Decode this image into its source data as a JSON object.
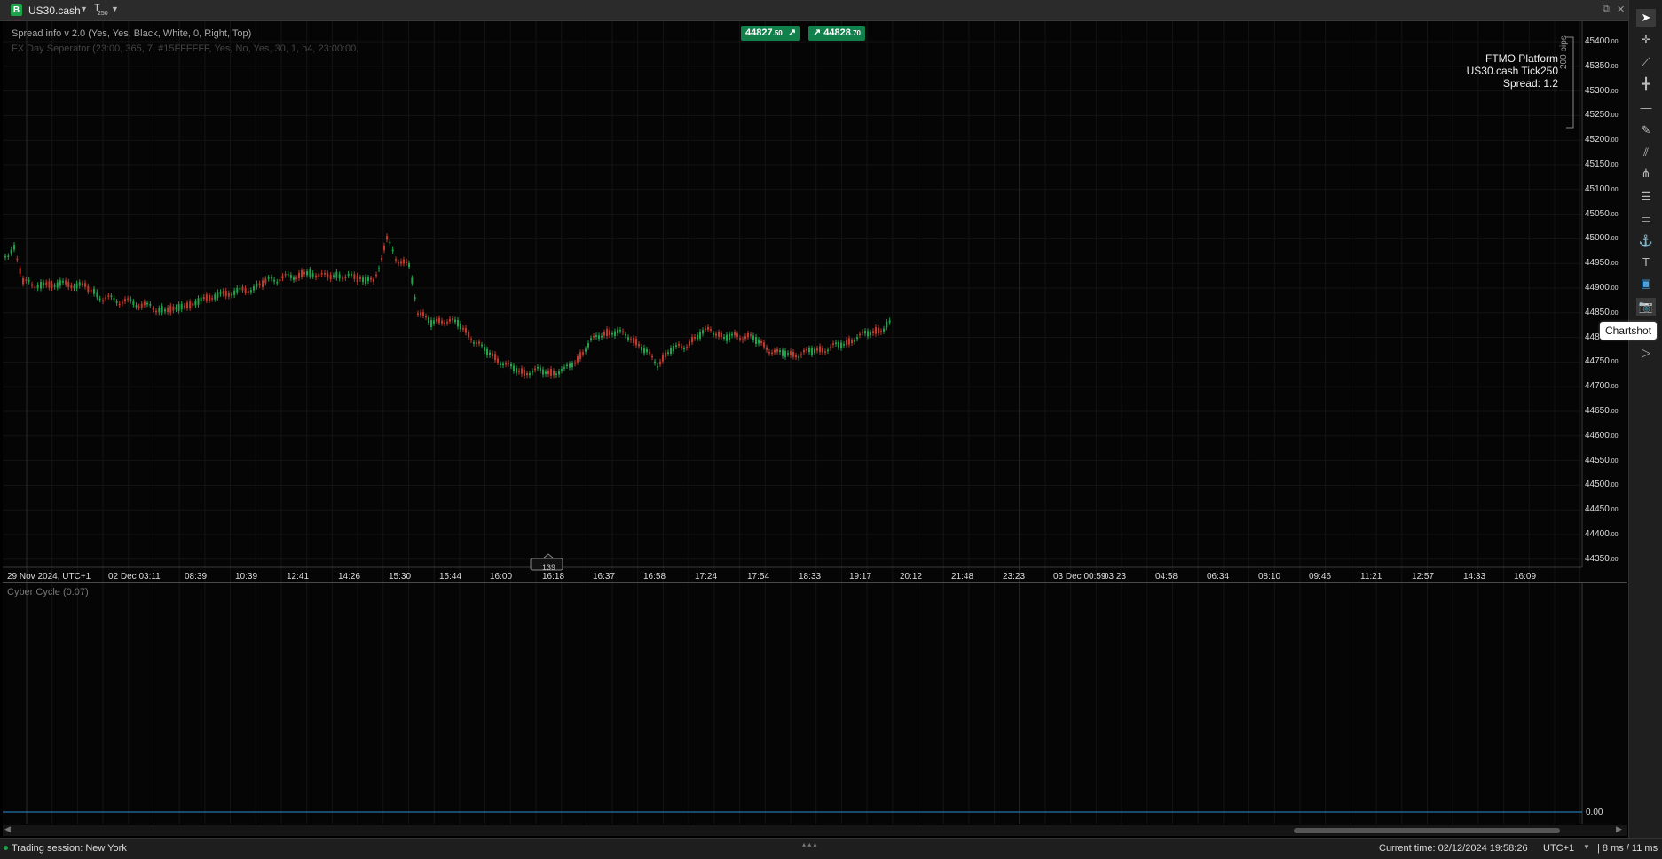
{
  "header": {
    "symbol_badge": "B",
    "symbol": "US30.cash",
    "timeframe_icon": "T",
    "timeframe_sub": "250"
  },
  "indicators": {
    "spread_info": "Spread info v 2.0 (Yes, Yes, Black, White, 0, Right, Top)",
    "day_separator": "FX Day Seperator (23:00, 365, 7, #15FFFFFF, Yes, No, Yes, 30, 1, h4, 23:00:00,",
    "cyber_cycle": "Cyber Cycle (0.07)"
  },
  "prices": {
    "bid_main": "44827",
    "bid_frac": ".50",
    "ask_main": "44828",
    "ask_frac": ".70"
  },
  "info_panel": {
    "line1": "FTMO Platform",
    "line2": "US30.cash Tick250",
    "line3": "Spread: 1.2"
  },
  "pips_label": "200 pips",
  "y_axis": [
    {
      "m": "45400",
      "f": ".00"
    },
    {
      "m": "45350",
      "f": ".00"
    },
    {
      "m": "45300",
      "f": ".00"
    },
    {
      "m": "45250",
      "f": ".00"
    },
    {
      "m": "45200",
      "f": ".00"
    },
    {
      "m": "45150",
      "f": ".00"
    },
    {
      "m": "45100",
      "f": ".00"
    },
    {
      "m": "45050",
      "f": ".00"
    },
    {
      "m": "45000",
      "f": ".00"
    },
    {
      "m": "44950",
      "f": ".00"
    },
    {
      "m": "44900",
      "f": ".00"
    },
    {
      "m": "44850",
      "f": ".00"
    },
    {
      "m": "448",
      "f": ""
    },
    {
      "m": "44750",
      "f": ".00"
    },
    {
      "m": "44700",
      "f": ".00"
    },
    {
      "m": "44650",
      "f": ".00"
    },
    {
      "m": "44600",
      "f": ".00"
    },
    {
      "m": "44550",
      "f": ".00"
    },
    {
      "m": "44500",
      "f": ".00"
    },
    {
      "m": "44450",
      "f": ".00"
    },
    {
      "m": "44400",
      "f": ".00"
    },
    {
      "m": "44350",
      "f": ".00"
    }
  ],
  "x_axis": [
    "29 Nov 2024, UTC+1",
    "02 Dec 03:11",
    "08:39",
    "10:39",
    "12:41",
    "14:26",
    "15:30",
    "15:44",
    "16:00",
    "16:18",
    "16:37",
    "16:58",
    "17:24",
    "17:54",
    "18:33",
    "19:17",
    "20:12",
    "21:48",
    "23:23",
    "03 Dec 00:59",
    "03:23",
    "04:58",
    "06:34",
    "08:10",
    "09:46",
    "11:21",
    "12:57",
    "14:33",
    "16:09"
  ],
  "cursor_bar": "139",
  "cyber_value": "0.00",
  "tooltip": "Chartshot",
  "status": {
    "session": "Trading session: New York",
    "current_time": "Current time: 02/12/2024 19:58:26",
    "timezone": "UTC+1",
    "latency": "8 ms / 11 ms"
  },
  "colors": {
    "up": "#1fa34a",
    "down": "#c0392b",
    "price_box": "#12804a",
    "cyber_line": "#2a8fd6"
  }
}
